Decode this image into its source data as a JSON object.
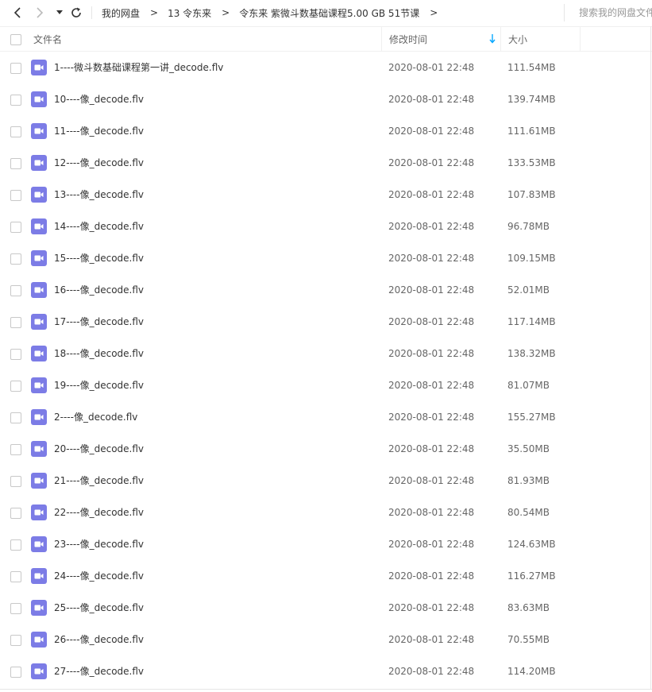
{
  "toolbar": {
    "breadcrumb": [
      "我的网盘",
      "13 令东来",
      "令东来 紫微斗数基础课程5.00 GB 51节课"
    ],
    "separator": ">",
    "search_placeholder": "搜索我的网盘文件"
  },
  "header": {
    "name": "文件名",
    "modified": "修改时间",
    "size": "大小"
  },
  "colors": {
    "video_icon": "#7c7ce6",
    "accent": "#06a7ff"
  },
  "files": [
    {
      "name": "1----微斗数基础课程第一讲_decode.flv",
      "date": "2020-08-01 22:48",
      "size": "111.54MB"
    },
    {
      "name": "10----像_decode.flv",
      "date": "2020-08-01 22:48",
      "size": "139.74MB"
    },
    {
      "name": "11----像_decode.flv",
      "date": "2020-08-01 22:48",
      "size": "111.61MB"
    },
    {
      "name": "12----像_decode.flv",
      "date": "2020-08-01 22:48",
      "size": "133.53MB"
    },
    {
      "name": "13----像_decode.flv",
      "date": "2020-08-01 22:48",
      "size": "107.83MB"
    },
    {
      "name": "14----像_decode.flv",
      "date": "2020-08-01 22:48",
      "size": "96.78MB"
    },
    {
      "name": "15----像_decode.flv",
      "date": "2020-08-01 22:48",
      "size": "109.15MB"
    },
    {
      "name": "16----像_decode.flv",
      "date": "2020-08-01 22:48",
      "size": "52.01MB"
    },
    {
      "name": "17----像_decode.flv",
      "date": "2020-08-01 22:48",
      "size": "117.14MB"
    },
    {
      "name": "18----像_decode.flv",
      "date": "2020-08-01 22:48",
      "size": "138.32MB"
    },
    {
      "name": "19----像_decode.flv",
      "date": "2020-08-01 22:48",
      "size": "81.07MB"
    },
    {
      "name": "2----像_decode.flv",
      "date": "2020-08-01 22:48",
      "size": "155.27MB"
    },
    {
      "name": "20----像_decode.flv",
      "date": "2020-08-01 22:48",
      "size": "35.50MB"
    },
    {
      "name": "21----像_decode.flv",
      "date": "2020-08-01 22:48",
      "size": "81.93MB"
    },
    {
      "name": "22----像_decode.flv",
      "date": "2020-08-01 22:48",
      "size": "80.54MB"
    },
    {
      "name": "23----像_decode.flv",
      "date": "2020-08-01 22:48",
      "size": "124.63MB"
    },
    {
      "name": "24----像_decode.flv",
      "date": "2020-08-01 22:48",
      "size": "116.27MB"
    },
    {
      "name": "25----像_decode.flv",
      "date": "2020-08-01 22:48",
      "size": "83.63MB"
    },
    {
      "name": "26----像_decode.flv",
      "date": "2020-08-01 22:48",
      "size": "70.55MB"
    },
    {
      "name": "27----像_decode.flv",
      "date": "2020-08-01 22:48",
      "size": "114.20MB"
    }
  ]
}
